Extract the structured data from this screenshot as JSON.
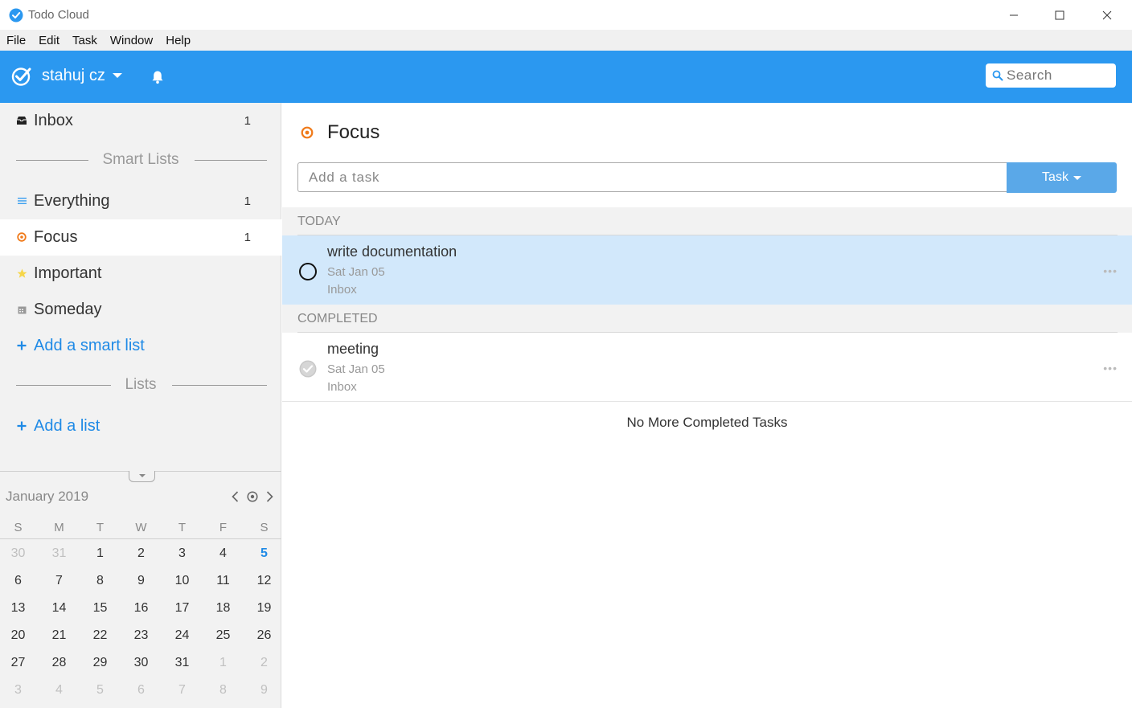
{
  "window": {
    "title": "Todo Cloud",
    "accent": "#2b98f0"
  },
  "menu": [
    "File",
    "Edit",
    "Task",
    "Window",
    "Help"
  ],
  "header": {
    "account_name": "stahuj cz",
    "search_placeholder": "Search"
  },
  "sidebar": {
    "inbox": {
      "label": "Inbox",
      "count": "1"
    },
    "smart_lists_heading": "Smart Lists",
    "smart_lists": [
      {
        "label": "Everything",
        "count": "1",
        "icon": "list-icon"
      },
      {
        "label": "Focus",
        "count": "1",
        "icon": "focus-icon",
        "active": true
      },
      {
        "label": "Important",
        "count": "",
        "icon": "star-icon"
      },
      {
        "label": "Someday",
        "count": "",
        "icon": "calendar-icon"
      }
    ],
    "add_smart_list": "Add a smart list",
    "lists_heading": "Lists",
    "add_list": "Add a list"
  },
  "calendar": {
    "month_label": "January 2019",
    "weekdays": [
      "S",
      "M",
      "T",
      "W",
      "T",
      "F",
      "S"
    ],
    "weeks": [
      [
        "30",
        "31",
        "1",
        "2",
        "3",
        "4",
        "5"
      ],
      [
        "6",
        "7",
        "8",
        "9",
        "10",
        "11",
        "12"
      ],
      [
        "13",
        "14",
        "15",
        "16",
        "17",
        "18",
        "19"
      ],
      [
        "20",
        "21",
        "22",
        "23",
        "24",
        "25",
        "26"
      ],
      [
        "27",
        "28",
        "29",
        "30",
        "31",
        "1",
        "2"
      ],
      [
        "3",
        "4",
        "5",
        "6",
        "7",
        "8",
        "9"
      ]
    ]
  },
  "main": {
    "title": "Focus",
    "add_task_placeholder": "Add a task",
    "task_type_button": "Task",
    "groups": [
      {
        "heading": "TODAY",
        "tasks": [
          {
            "name": "write documentation",
            "date": "Sat Jan 05",
            "list": "Inbox",
            "completed": false
          }
        ]
      },
      {
        "heading": "COMPLETED",
        "tasks": [
          {
            "name": "meeting",
            "date": "Sat Jan 05",
            "list": "Inbox",
            "completed": true
          }
        ]
      }
    ],
    "no_more_text": "No More Completed Tasks"
  }
}
